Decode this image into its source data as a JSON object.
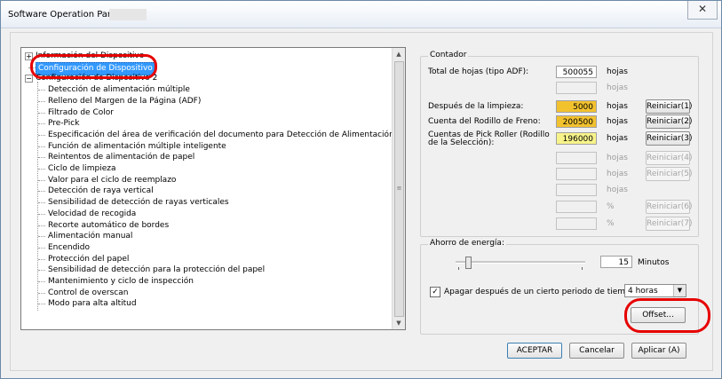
{
  "window": {
    "title": "Software Operation Panel fi-",
    "close_glyph": "✕"
  },
  "tree": {
    "items": [
      {
        "label": "Información del Dispositivo",
        "level": 0,
        "expander": "+"
      },
      {
        "label": "Configuración de Dispositivo",
        "level": 0,
        "selected": true
      },
      {
        "label": "Configuración de Dispositivo 2",
        "level": 0,
        "expander": "−"
      },
      {
        "label": "Detección de alimentación múltiple",
        "level": 1
      },
      {
        "label": "Relleno del Margen de la Página (ADF)",
        "level": 1
      },
      {
        "label": "Filtrado de Color",
        "level": 1
      },
      {
        "label": "Pre-Pick",
        "level": 1
      },
      {
        "label": "Especificación del área de verificación del documento para Detección de Alimentación Múltiple",
        "level": 1
      },
      {
        "label": "Función de alimentación múltiple inteligente",
        "level": 1
      },
      {
        "label": "Reintentos de alimentación de papel",
        "level": 1
      },
      {
        "label": "Ciclo de limpieza",
        "level": 1
      },
      {
        "label": "Valor para el ciclo de reemplazo",
        "level": 1
      },
      {
        "label": "Detección de raya vertical",
        "level": 1
      },
      {
        "label": "Sensibilidad de detección de rayas verticales",
        "level": 1
      },
      {
        "label": "Velocidad de recogida",
        "level": 1
      },
      {
        "label": "Recorte automático de bordes",
        "level": 1
      },
      {
        "label": "Alimentación manual",
        "level": 1
      },
      {
        "label": "Encendido",
        "level": 1
      },
      {
        "label": "Protección del papel",
        "level": 1
      },
      {
        "label": "Sensibilidad de detección para la protección del papel",
        "level": 1
      },
      {
        "label": "Mantenimiento y ciclo de inspección",
        "level": 1
      },
      {
        "label": "Control de overscan",
        "level": 1
      },
      {
        "label": "Modo para alta altitud",
        "level": 1
      }
    ],
    "scroll_up": "▲",
    "scroll_down": "▼",
    "scroll_grip": "≡"
  },
  "counter": {
    "group_title": "Contador",
    "rows": [
      {
        "label": "Total de hojas (tipo ADF):",
        "value": "500055",
        "unit": "hojas",
        "unit_disabled": false,
        "button": null
      },
      {
        "label": "",
        "value": "",
        "unit": "hojas",
        "unit_disabled": true,
        "button": null
      },
      {
        "label": "Después de la limpieza:",
        "value": "5000",
        "unit": "hojas",
        "unit_disabled": false,
        "button": "Reiniciar(1)",
        "btn_disabled": false,
        "color": "yellow"
      },
      {
        "label": "Cuenta del Rodillo de Freno:",
        "value": "200500",
        "unit": "hojas",
        "unit_disabled": false,
        "button": "Reiniciar(2)",
        "btn_disabled": false,
        "color": "yellow"
      },
      {
        "label": "Cuentas de Pick Roller (Rodillo de la  Selección):",
        "value": "196000",
        "unit": "hojas",
        "unit_disabled": false,
        "button": "Reiniciar(3)",
        "btn_disabled": false,
        "color": "lemon"
      },
      {
        "label": "",
        "value": "",
        "unit": "hojas",
        "unit_disabled": true,
        "button": "Reiniciar(4)",
        "btn_disabled": true
      },
      {
        "label": "",
        "value": "",
        "unit": "hojas",
        "unit_disabled": true,
        "button": "Reiniciar(5)",
        "btn_disabled": true
      },
      {
        "label": "",
        "value": "",
        "unit": "hojas",
        "unit_disabled": true,
        "button": null
      },
      {
        "label": "",
        "value": "",
        "unit": "%",
        "unit_disabled": true,
        "button": "Reiniciar(6)",
        "btn_disabled": true
      },
      {
        "label": "",
        "value": "",
        "unit": "%",
        "unit_disabled": true,
        "button": "Reiniciar(7)",
        "btn_disabled": true
      }
    ]
  },
  "energy": {
    "group_title": "Ahorro de energía:",
    "minutes_value": "15",
    "minutes_unit": "Minutos",
    "checkbox_checked": true,
    "checkbox_mark": "✓",
    "checkbox_label": "Apagar después de un cierto periodo de tiempo",
    "select_value": "4 horas",
    "select_arrow": "▼",
    "offset_button": "Offset..."
  },
  "footer": {
    "ok_label": "ACEPTAR",
    "cancel_label": "Cancelar",
    "apply_label": "Aplicar (A)"
  }
}
